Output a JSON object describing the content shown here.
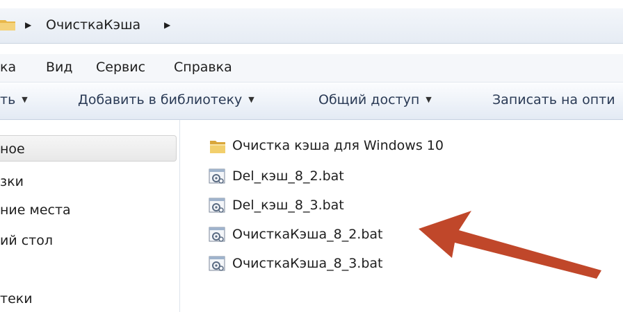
{
  "address": {
    "crumbs": [
      "ОчисткаКэша"
    ],
    "separator_icon": "triangle-right-icon"
  },
  "menu": {
    "items": [
      "ка",
      "Вид",
      "Сервис",
      "Справка"
    ]
  },
  "toolbar": {
    "items": [
      {
        "label": "ть",
        "has_dropdown": true
      },
      {
        "label": "Добавить в библиотеку",
        "has_dropdown": true
      },
      {
        "label": "Общий доступ",
        "has_dropdown": true
      },
      {
        "label": "Записать на опти",
        "has_dropdown": false
      }
    ]
  },
  "nav": {
    "items": [
      "ное",
      "зки",
      "ние места",
      "ий стол",
      "теки"
    ],
    "selected_index": 0
  },
  "files": [
    {
      "name": "Очистка кэша для Windows 10",
      "icon": "folder-icon"
    },
    {
      "name": "Del_кэш_8_2.bat",
      "icon": "batch-file-icon"
    },
    {
      "name": "Del_кэш_8_3.bat",
      "icon": "batch-file-icon"
    },
    {
      "name": "ОчисткаКэша_8_2.bat",
      "icon": "batch-file-icon"
    },
    {
      "name": "ОчисткаКэша_8_3.bat",
      "icon": "batch-file-icon"
    }
  ],
  "annotation": {
    "arrow_color": "#c0472a",
    "points_to": "batch files"
  }
}
